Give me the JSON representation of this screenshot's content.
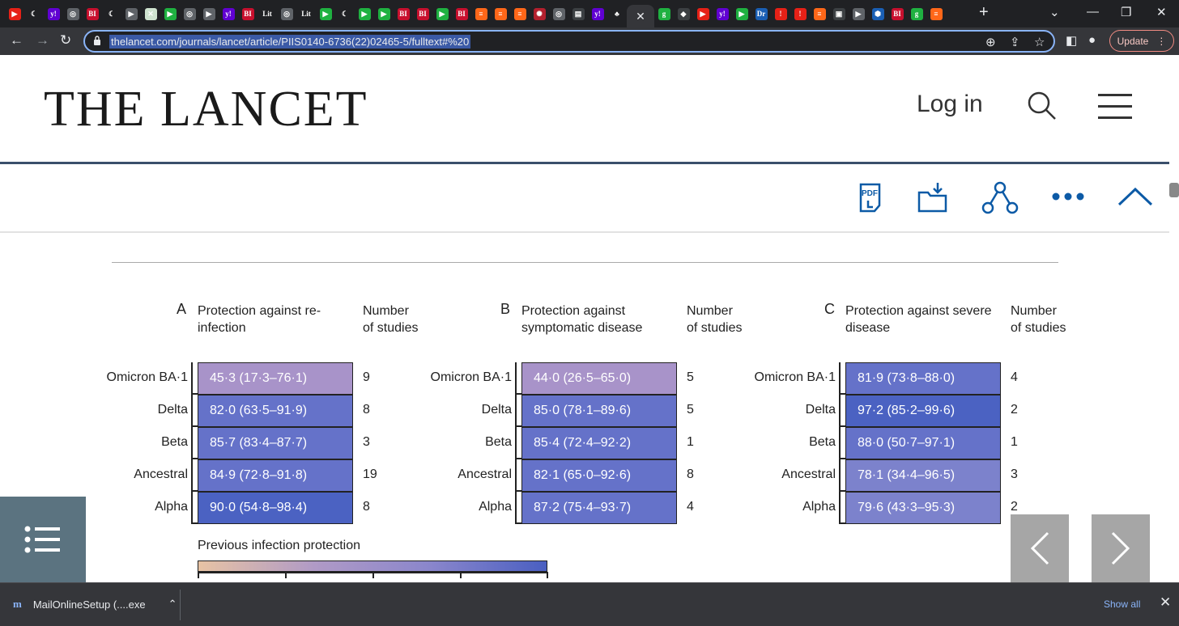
{
  "browser": {
    "url": "thelancet.com/journals/lancet/article/PIIS0140-6736(22)02465-5/fulltext#%20",
    "update_label": "Update",
    "tab_icons": [
      {
        "icon": "youtube-icon",
        "text": "▶",
        "color": "#e62117"
      },
      {
        "icon": "crescent-icon",
        "text": "☾",
        "color": "#202124"
      },
      {
        "icon": "yahoo-icon",
        "text": "y!",
        "color": "#6001d2"
      },
      {
        "icon": "globe-icon",
        "text": "◎",
        "color": "#5f6368"
      },
      {
        "icon": "bi-icon",
        "text": "BI",
        "color": "#c8102e"
      },
      {
        "icon": "crescent-icon",
        "text": "☾",
        "color": "#202124"
      },
      {
        "icon": "bookmark-icon",
        "text": "▶",
        "color": "#5f6368"
      },
      {
        "icon": "map-icon",
        "text": "✕",
        "color": "#cfe3cf"
      },
      {
        "icon": "play-icon",
        "text": "▶",
        "color": "#1fb141"
      },
      {
        "icon": "globe-icon",
        "text": "◎",
        "color": "#5f6368"
      },
      {
        "icon": "bookmark-icon",
        "text": "▶",
        "color": "#5f6368"
      },
      {
        "icon": "yahoo-icon",
        "text": "y!",
        "color": "#6001d2"
      },
      {
        "icon": "bi-icon",
        "text": "BI",
        "color": "#c8102e"
      },
      {
        "icon": "lit-icon",
        "text": "Lit",
        "color": "#202124"
      },
      {
        "icon": "globe-icon",
        "text": "◎",
        "color": "#5f6368"
      },
      {
        "icon": "lit-icon",
        "text": "Lit",
        "color": "#202124"
      },
      {
        "icon": "play-icon",
        "text": "▶",
        "color": "#1fb141"
      },
      {
        "icon": "crescent-icon",
        "text": "☾",
        "color": "#202124"
      },
      {
        "icon": "play-icon",
        "text": "▶",
        "color": "#1fb141"
      },
      {
        "icon": "play-icon",
        "text": "▶",
        "color": "#1fb141"
      },
      {
        "icon": "bi-icon",
        "text": "BI",
        "color": "#c8102e"
      },
      {
        "icon": "bi-icon",
        "text": "BI",
        "color": "#c8102e"
      },
      {
        "icon": "play-icon",
        "text": "▶",
        "color": "#1fb141"
      },
      {
        "icon": "bi-icon",
        "text": "BI",
        "color": "#c8102e"
      },
      {
        "icon": "substack-icon",
        "text": "≡",
        "color": "#ff6719"
      },
      {
        "icon": "substack-icon",
        "text": "≡",
        "color": "#ff6719"
      },
      {
        "icon": "substack-icon",
        "text": "≡",
        "color": "#ff6719"
      },
      {
        "icon": "burst-icon",
        "text": "✺",
        "color": "#b3202e"
      },
      {
        "icon": "globe-icon",
        "text": "◎",
        "color": "#5f6368"
      },
      {
        "icon": "news-icon",
        "text": "▤",
        "color": "#3c4043"
      },
      {
        "icon": "yahoo-icon",
        "text": "y!",
        "color": "#6001d2"
      },
      {
        "icon": "bird-icon",
        "text": "♣",
        "color": "#202124"
      }
    ],
    "tab_icons_after": [
      {
        "icon": "g-icon",
        "text": "g",
        "color": "#1fb141"
      },
      {
        "icon": "shield-icon",
        "text": "◆",
        "color": "#3c4043"
      },
      {
        "icon": "youtube-icon",
        "text": "▶",
        "color": "#e62117"
      },
      {
        "icon": "yahoo-icon",
        "text": "y!",
        "color": "#6001d2"
      },
      {
        "icon": "play-icon",
        "text": "▶",
        "color": "#1fb141"
      },
      {
        "icon": "dr-icon",
        "text": "Dr",
        "color": "#1a5fb4"
      },
      {
        "icon": "alert-icon",
        "text": "!",
        "color": "#e62117"
      },
      {
        "icon": "alert-icon",
        "text": "!",
        "color": "#e62117"
      },
      {
        "icon": "substack-icon",
        "text": "≡",
        "color": "#ff6719"
      },
      {
        "icon": "sqr-icon",
        "text": "▣",
        "color": "#3c4043"
      },
      {
        "icon": "bookmark-icon",
        "text": "▶",
        "color": "#5f6368"
      },
      {
        "icon": "hex-icon",
        "text": "⬢",
        "color": "#1a5fb4"
      },
      {
        "icon": "bi-icon",
        "text": "BI",
        "color": "#c8102e"
      },
      {
        "icon": "g-icon",
        "text": "g",
        "color": "#1fb141"
      },
      {
        "icon": "substack-icon",
        "text": "≡",
        "color": "#ff6719"
      }
    ]
  },
  "site": {
    "logo": "THE LANCET",
    "login_label": "Log in",
    "accent": "#0c5aa6"
  },
  "figure": {
    "panels": [
      {
        "letter": "A",
        "title": "Protection against re-infection",
        "count_header": "Number of studies",
        "rows": [
          {
            "label": "Omicron BA·1",
            "value": "45·3 (17·3–76·1)",
            "count": "9"
          },
          {
            "label": "Delta",
            "value": "82·0 (63·5–91·9)",
            "count": "8"
          },
          {
            "label": "Beta",
            "value": "85·7 (83·4–87·7)",
            "count": "3"
          },
          {
            "label": "Ancestral",
            "value": "84·9 (72·8–91·8)",
            "count": "19"
          },
          {
            "label": "Alpha",
            "value": "90·0 (54·8–98·4)",
            "count": "8"
          }
        ]
      },
      {
        "letter": "B",
        "title": "Protection against symptomatic disease",
        "count_header": "Number of studies",
        "rows": [
          {
            "label": "Omicron BA·1",
            "value": "44·0 (26·5–65·0)",
            "count": "5"
          },
          {
            "label": "Delta",
            "value": "85·0 (78·1–89·6)",
            "count": "5"
          },
          {
            "label": "Beta",
            "value": "85·4 (72·4–92·2)",
            "count": "1"
          },
          {
            "label": "Ancestral",
            "value": "82·1 (65·0–92·6)",
            "count": "8"
          },
          {
            "label": "Alpha",
            "value": "87·2 (75·4–93·7)",
            "count": "4"
          }
        ]
      },
      {
        "letter": "C",
        "title": "Protection against severe disease",
        "count_header": "Number of studies",
        "rows": [
          {
            "label": "Omicron BA·1",
            "value": "81·9 (73·8–88·0)",
            "count": "4"
          },
          {
            "label": "Delta",
            "value": "97·2 (85·2–99·6)",
            "count": "2"
          },
          {
            "label": "Beta",
            "value": "88·0 (50·7–97·1)",
            "count": "1"
          },
          {
            "label": "Ancestral",
            "value": "78·1 (34·4–96·5)",
            "count": "3"
          },
          {
            "label": "Alpha",
            "value": "79·6 (43·3–95·3)",
            "count": "2"
          }
        ]
      }
    ],
    "legend_title": "Previous infection protection",
    "color_scale": {
      "low": "#e7c3a4",
      "mid": "#b09ac6",
      "high": "#4a5fc1"
    }
  },
  "downloads": {
    "file_label": "MailOnlineSetup (....exe",
    "show_all_label": "Show all"
  }
}
